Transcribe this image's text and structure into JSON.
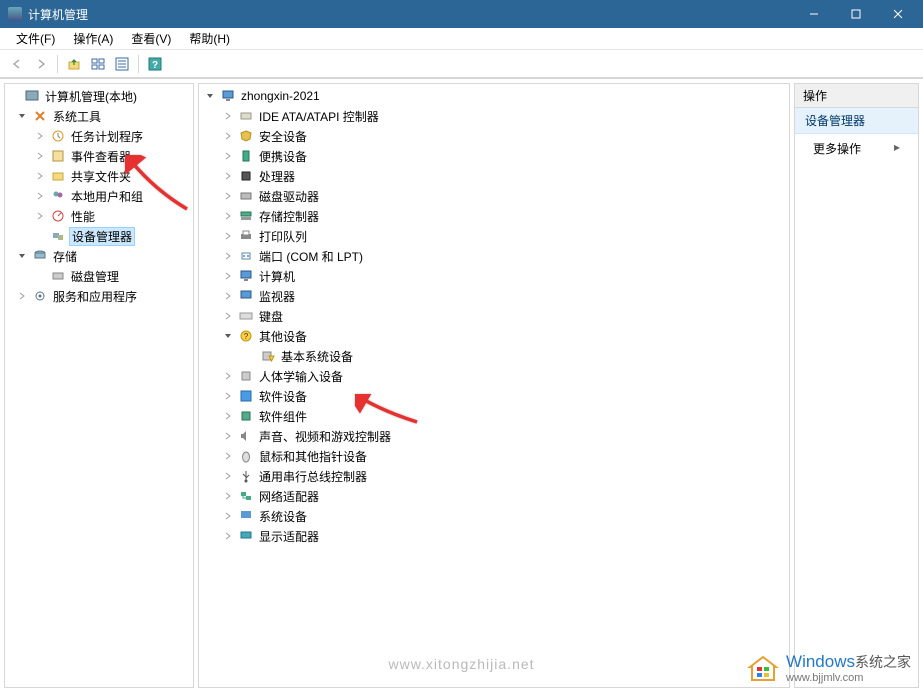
{
  "window": {
    "title": "计算机管理"
  },
  "menu": {
    "file": "文件(F)",
    "action": "操作(A)",
    "view": "查看(V)",
    "help": "帮助(H)"
  },
  "left_tree": {
    "root": "计算机管理(本地)",
    "system_tools": "系统工具",
    "task_scheduler": "任务计划程序",
    "event_viewer": "事件查看器",
    "shared_folders": "共享文件夹",
    "local_users": "本地用户和组",
    "performance": "性能",
    "device_manager": "设备管理器",
    "storage": "存储",
    "disk_management": "磁盘管理",
    "services_apps": "服务和应用程序"
  },
  "mid_tree": {
    "root": "zhongxin-2021",
    "ide": "IDE ATA/ATAPI 控制器",
    "security": "安全设备",
    "portable": "便携设备",
    "processors": "处理器",
    "disk_drives": "磁盘驱动器",
    "storage_ctrl": "存储控制器",
    "print_queues": "打印队列",
    "ports": "端口 (COM 和 LPT)",
    "computers": "计算机",
    "monitors": "监视器",
    "keyboards": "键盘",
    "other_devices": "其他设备",
    "base_system_device": "基本系统设备",
    "hid": "人体学输入设备",
    "software_devices": "软件设备",
    "software_components": "软件组件",
    "sound": "声音、视频和游戏控制器",
    "mice": "鼠标和其他指针设备",
    "usb": "通用串行总线控制器",
    "network": "网络适配器",
    "system_devices": "系统设备",
    "display": "显示适配器"
  },
  "right_pane": {
    "header": "操作",
    "subhead": "设备管理器",
    "more_actions": "更多操作"
  },
  "watermark": {
    "text1": "www.xitongzhijia.net",
    "brand1": "Windows",
    "brand2": "系统之家",
    "url": "www.bjjmlv.com"
  }
}
